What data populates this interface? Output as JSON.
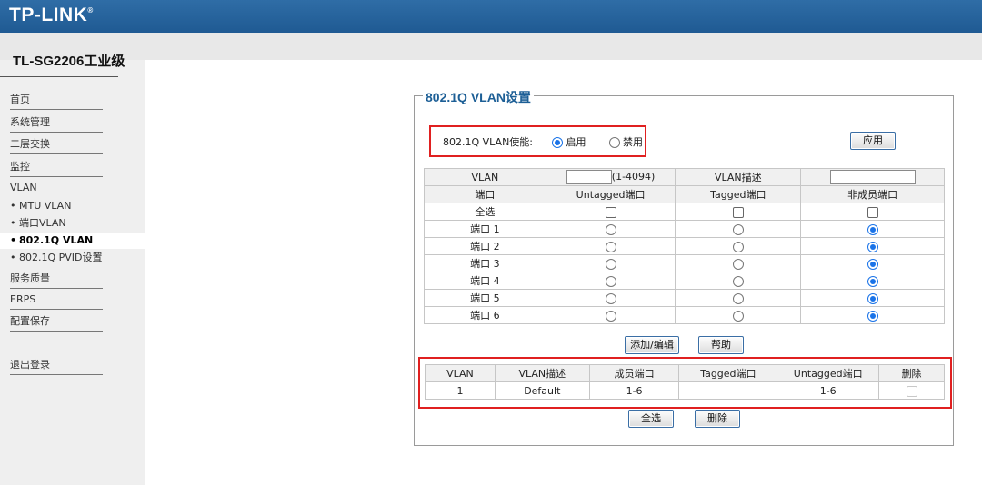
{
  "brand": {
    "logo": "TP-LINK",
    "registered": "®",
    "model": "TL-SG2206工业级"
  },
  "sidebar": {
    "items": [
      {
        "label": "首页"
      },
      {
        "label": "系统管理"
      },
      {
        "label": "二层交换"
      },
      {
        "label": "监控"
      },
      {
        "label": "VLAN"
      },
      {
        "label": "MTU VLAN"
      },
      {
        "label": "端口VLAN"
      },
      {
        "label": "802.1Q VLAN"
      },
      {
        "label": "802.1Q PVID设置"
      },
      {
        "label": "服务质量"
      },
      {
        "label": "ERPS"
      },
      {
        "label": "配置保存"
      },
      {
        "label": "退出登录"
      }
    ],
    "bullet": "•"
  },
  "panel": {
    "legend": "802.1Q VLAN设置",
    "enable_label": "802.1Q VLAN使能:",
    "enable_on": "启用",
    "enable_off": "禁用",
    "apply_button": "应用"
  },
  "port_table": {
    "vlan_label": "VLAN",
    "vlan_value": "",
    "vlan_range": "(1-4094)",
    "desc_label": "VLAN描述",
    "desc_value": "",
    "headers": [
      "端口",
      "Untagged端口",
      "Tagged端口",
      "非成员端口"
    ],
    "select_all": "全选",
    "ports": [
      "端口 1",
      "端口 2",
      "端口 3",
      "端口 4",
      "端口 5",
      "端口 6"
    ],
    "selected_mode": "非成员端口"
  },
  "actions": {
    "add_edit": "添加/编辑",
    "help": "帮助"
  },
  "vlan_list": {
    "headers": [
      "VLAN",
      "VLAN描述",
      "成员端口",
      "Tagged端口",
      "Untagged端口",
      "删除"
    ],
    "rows": [
      {
        "vlan": "1",
        "desc": "Default",
        "members": "1-6",
        "tagged": "",
        "untagged": "1-6"
      }
    ],
    "select_all_button": "全选",
    "delete_button": "删除"
  },
  "colors": {
    "header_blue": "#1f5a93",
    "highlight_red": "#e02020",
    "radio_blue": "#1a73e8"
  }
}
